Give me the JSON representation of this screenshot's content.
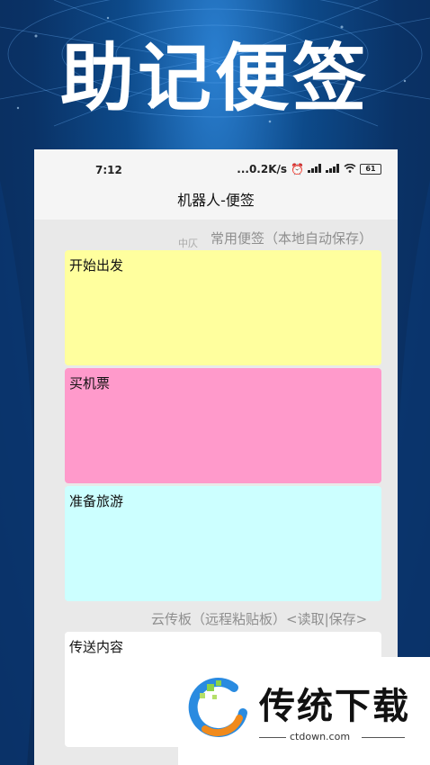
{
  "hero": {
    "title": "助记便签"
  },
  "status_bar": {
    "time": "7:12",
    "network_speed": "...0.2K/s",
    "battery": "61"
  },
  "app": {
    "title": "机器人-便签"
  },
  "notes_section": {
    "label": "常用便签（本地自动保存）",
    "ghost_label": "中仄",
    "notes": [
      {
        "text": "开始出发",
        "color": "#ffff9e"
      },
      {
        "text": "买机票",
        "color": "#ff9acb"
      },
      {
        "text": "准备旅游",
        "color": "#ccffff"
      }
    ]
  },
  "cloud_section": {
    "label_prefix": "云传板（远程粘贴板）",
    "read_label": "<读取",
    "separator": "|",
    "save_label": "保存>",
    "content": "传送内容"
  },
  "watermark": {
    "brand": "传统下载",
    "domain": "ctdown.com"
  }
}
